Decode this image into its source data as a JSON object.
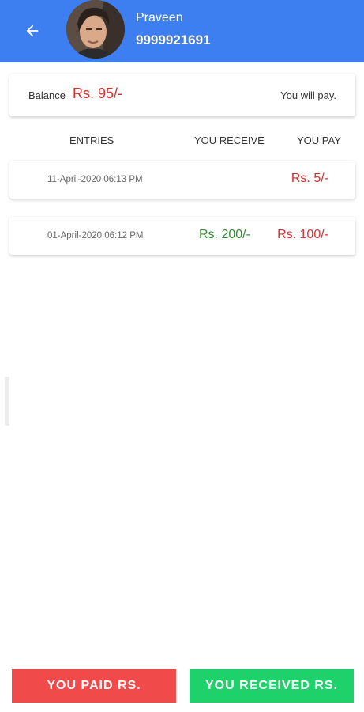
{
  "header": {
    "name": "Praveen",
    "phone": "9999921691",
    "back_icon": "arrow-left-icon",
    "color": "#3d7ef0"
  },
  "balance": {
    "label": "Balance",
    "amount": "Rs. 95/-",
    "note": "You will pay."
  },
  "columns": {
    "entries": "ENTRIES",
    "you_receive": "YOU RECEIVE",
    "you_pay": "YOU PAY"
  },
  "entries": [
    {
      "date": "11-April-2020 06:13 PM",
      "receive": "",
      "pay": "Rs. 5/-"
    },
    {
      "date": "01-April-2020 06:12 PM",
      "receive": "Rs. 200/-",
      "pay": "Rs. 100/-"
    }
  ],
  "actions": {
    "paid_label": "YOU PAID RS.",
    "received_label": "YOU RECEIVED RS."
  },
  "colors": {
    "pay_red": "#d32f2f",
    "receive_green": "#2e8b2e",
    "paid_button": "#f04a4a",
    "received_button": "#1fd16a"
  }
}
